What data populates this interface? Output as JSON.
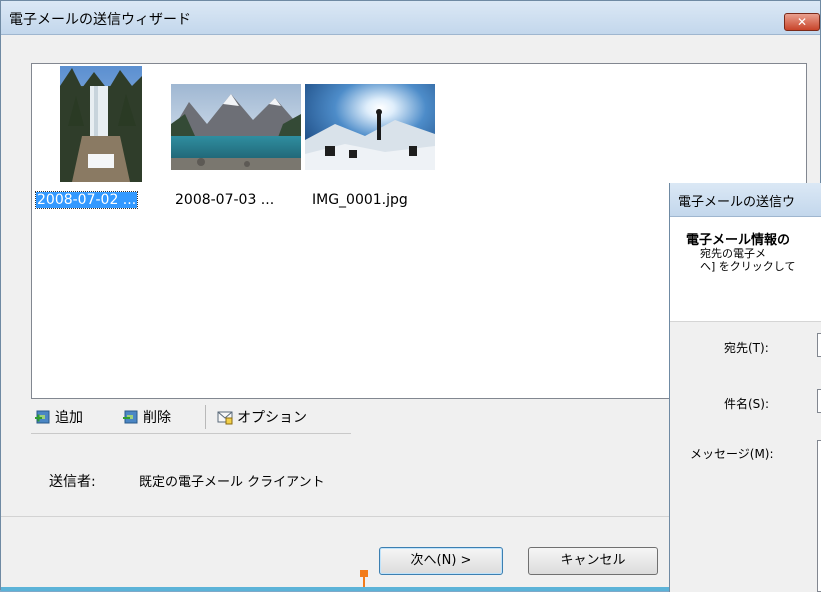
{
  "window": {
    "title": "電子メールの送信ウィザード",
    "close_label": "✕"
  },
  "gallery": {
    "items": [
      {
        "caption": "2008-07-02 ...",
        "thumb": "waterfall-photo",
        "selected": true
      },
      {
        "caption": "2008-07-03 ...",
        "thumb": "mountain-lake-photo",
        "selected": false
      },
      {
        "caption": "IMG_0001.jpg",
        "thumb": "sunburst-hikers-photo",
        "selected": false
      }
    ]
  },
  "toolbar": {
    "add_label": "追加",
    "delete_label": "削除",
    "options_label": "オプション"
  },
  "sender": {
    "label": "送信者:",
    "value": "既定の電子メール クライアント"
  },
  "buttons": {
    "next_label": "次へ(N) >",
    "cancel_label": "キャンセル"
  },
  "second_window": {
    "title": "電子メールの送信ウ",
    "heading": "電子メール情報の",
    "desc_line1": "宛先の電子メ",
    "desc_line2": "へ] をクリックして",
    "to_label": "宛先(T):",
    "subject_label": "件名(S):",
    "message_label": "メッセージ(M):"
  },
  "colors": {
    "selection": "#3399ff",
    "title_bar": "#c3d7ec",
    "accent": "#f27b1a"
  }
}
